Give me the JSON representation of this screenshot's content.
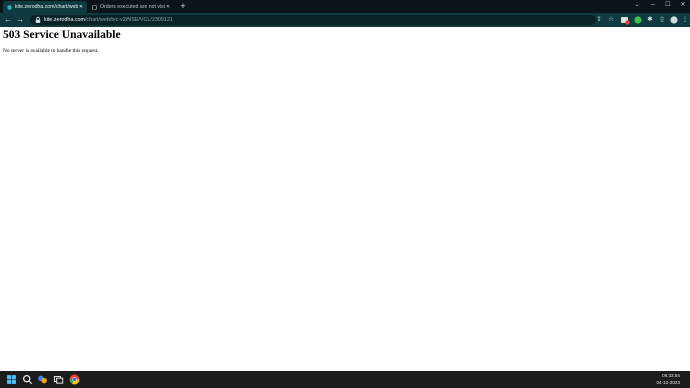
{
  "browser": {
    "tabs": [
      {
        "label": "kite.zerodha.com/chart/web/tvc",
        "active": true
      },
      {
        "label": "Orders executed are not visible",
        "active": false
      }
    ],
    "url_host": "kite.zerodha.com",
    "url_path": "/chart/web/tvc-v2/NSE/VCL/2309121"
  },
  "page": {
    "heading": "503 Service Unavailable",
    "message": "No server is available to handle this request."
  },
  "taskbar": {
    "time": "09:33:54",
    "date": "04-12-2023"
  },
  "colors": {
    "tabbar": "#0b1418",
    "toolbar": "#0f3a40",
    "taskbar": "#1c1c1c"
  }
}
